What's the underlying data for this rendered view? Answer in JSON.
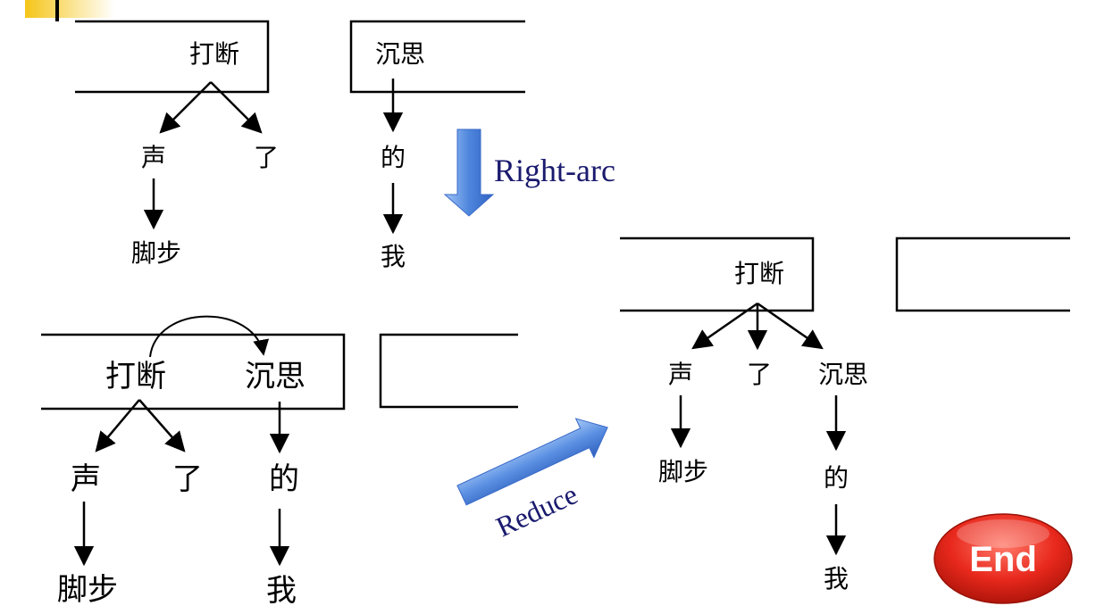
{
  "state1": {
    "stack_words": [
      "打断"
    ],
    "buffer_words": [
      "沉思"
    ],
    "tree_left": {
      "head": "打断",
      "children": [
        "声",
        "了"
      ],
      "grandchild": "脚步"
    },
    "tree_right": {
      "child": "的",
      "grandchild": "我"
    }
  },
  "state2": {
    "stack_words": [
      "打断",
      "沉思"
    ],
    "tree_left": {
      "children": [
        "声",
        "了"
      ],
      "grandchild": "脚步"
    },
    "tree_right": {
      "child": "的",
      "grandchild": "我"
    }
  },
  "state3": {
    "stack_words": [
      "打断"
    ],
    "tree": {
      "children": [
        "声",
        "了",
        "沉思"
      ],
      "grandchild_1": "脚步",
      "grandchild_3a": "的",
      "grandchild_3b": "我"
    }
  },
  "transitions": {
    "right_arc": "Right-arc",
    "reduce": "Reduce"
  },
  "end_label": "End",
  "colors": {
    "label_text": "#1a1a6e",
    "arrow_blue": "#5b8fe0",
    "end_red": "#e8281c",
    "corner_yellow": "#f5c518"
  }
}
